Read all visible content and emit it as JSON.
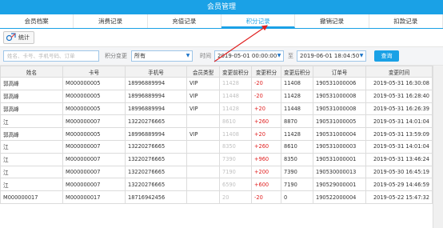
{
  "window": {
    "title": "会员管理"
  },
  "tabs": [
    {
      "label": "会员档案",
      "active": false
    },
    {
      "label": "消费记录",
      "active": false
    },
    {
      "label": "充值记录",
      "active": false
    },
    {
      "label": "积分记录",
      "active": true
    },
    {
      "label": "撤销记录",
      "active": false
    },
    {
      "label": "扣款记录",
      "active": false
    }
  ],
  "toolbar": {
    "stat_label": "统计"
  },
  "filter": {
    "search_placeholder": "姓名、卡号、手机号码、订单",
    "type_label": "积分变更",
    "type_value": "所有",
    "time_label": "时间",
    "start_time": "2019-05-01 00:00:00",
    "to_label": "至",
    "end_time": "2019-06-01 18:04:50",
    "query_label": "查询"
  },
  "table": {
    "columns": [
      "姓名",
      "卡号",
      "手机号",
      "会员类型",
      "变更前积分",
      "变更积分",
      "变更后积分",
      "订单号",
      "变更时间"
    ],
    "rows": [
      [
        "郭高峰",
        "M000000005",
        "18996889994",
        "VIP",
        "11428",
        "-20",
        "11408",
        "190531000006",
        "2019-05-31 16:30:08"
      ],
      [
        "郭高峰",
        "M000000005",
        "18996889994",
        "VIP",
        "11448",
        "-20",
        "11428",
        "190531000008",
        "2019-05-31 16:28:40"
      ],
      [
        "郭高峰",
        "M000000005",
        "18996889994",
        "VIP",
        "11428",
        "+20",
        "11448",
        "190531000008",
        "2019-05-31 16:26:39"
      ],
      [
        "江",
        "M000000007",
        "13220276665",
        "",
        "8610",
        "+260",
        "8870",
        "190531000005",
        "2019-05-31 14:01:04"
      ],
      [
        "郭高峰",
        "M000000005",
        "18996889994",
        "VIP",
        "11408",
        "+20",
        "11428",
        "190531000004",
        "2019-05-31 13:59:09"
      ],
      [
        "江",
        "M000000007",
        "13220276665",
        "",
        "8350",
        "+260",
        "8610",
        "190531000003",
        "2019-05-31 14:01:04"
      ],
      [
        "江",
        "M000000007",
        "13220276665",
        "",
        "7390",
        "+960",
        "8350",
        "190531000001",
        "2019-05-31 13:46:24"
      ],
      [
        "江",
        "M000000007",
        "13220276665",
        "",
        "7190",
        "+200",
        "7390",
        "190530000013",
        "2019-05-30 16:45:19"
      ],
      [
        "江",
        "M000000007",
        "13220276665",
        "",
        "6590",
        "+600",
        "7190",
        "190529000001",
        "2019-05-29 14:46:59"
      ],
      [
        "M000000017",
        "M000000017",
        "18716942456",
        "",
        "20",
        "-20",
        "0",
        "190522000004",
        "2019-05-22 15:47:32"
      ]
    ]
  },
  "colors": {
    "accent": "#1aa1e6",
    "positive": "#e02020",
    "annotation_arrow": "#e02020"
  }
}
